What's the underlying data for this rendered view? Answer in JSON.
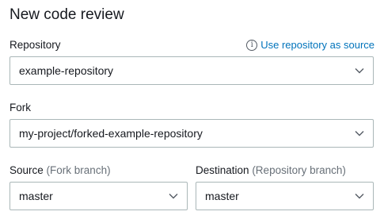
{
  "page": {
    "title": "New code review"
  },
  "repository": {
    "label": "Repository",
    "info_link": "Use repository as source",
    "value": "example-repository"
  },
  "fork": {
    "label": "Fork",
    "value": "my-project/forked-example-repository"
  },
  "source": {
    "label": "Source",
    "hint": "(Fork branch)",
    "value": "master"
  },
  "destination": {
    "label": "Destination",
    "hint": "(Repository branch)",
    "value": "master"
  },
  "icons": {
    "info": "info-icon",
    "dropdown": "chevron-down-icon"
  },
  "colors": {
    "link": "#0073bb",
    "muted": "#687078",
    "border": "#aab7b8",
    "text": "#16191f"
  }
}
